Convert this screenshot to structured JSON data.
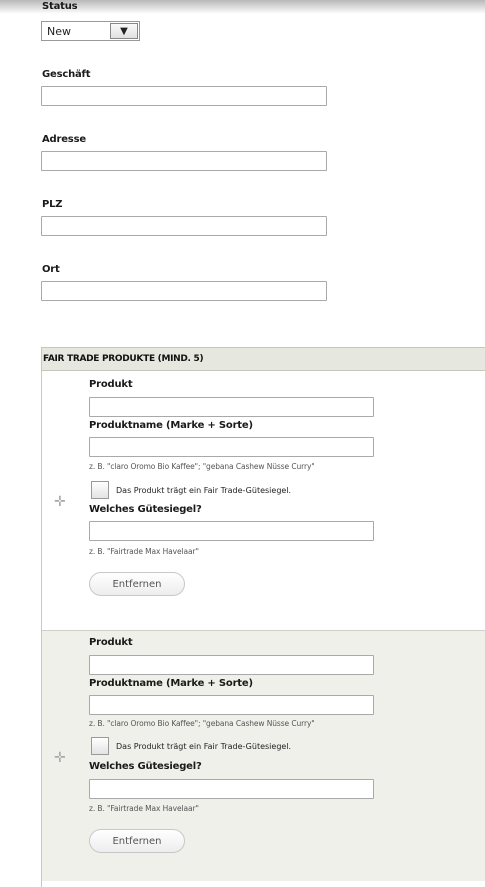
{
  "status": {
    "label": "Status",
    "value": "New"
  },
  "fields": {
    "geschaeft": "Geschäft",
    "adresse": "Adresse",
    "plz": "PLZ",
    "ort": "Ort"
  },
  "products_section": {
    "title": "FAIR TRADE PRODUKTE (MIND. 5)",
    "items": [
      {
        "produkt_label": "Produkt",
        "produktname_label": "Produktname (Marke + Sorte)",
        "produktname_hint": "z. B. \"claro Oromo Bio Kaffee\"; \"gebana Cashew Nüsse Curry\"",
        "siegel_checkbox_label": "Das Produkt trägt ein Fair Trade-Gütesiegel.",
        "siegel_label": "Welches Gütesiegel?",
        "siegel_hint": "z. B. \"Fairtrade Max Havelaar\"",
        "remove_label": "Entfernen"
      },
      {
        "produkt_label": "Produkt",
        "produktname_label": "Produktname (Marke + Sorte)",
        "produktname_hint": "z. B. \"claro Oromo Bio Kaffee\"; \"gebana Cashew Nüsse Curry\"",
        "siegel_checkbox_label": "Das Produkt trägt ein Fair Trade-Gütesiegel.",
        "siegel_label": "Welches Gütesiegel?",
        "siegel_hint": "z. B. \"Fairtrade Max Havelaar\"",
        "remove_label": "Entfernen"
      }
    ]
  },
  "colors": {
    "section_header_bg": "#e6e8e0",
    "alt_row_bg": "#eff0ea"
  }
}
